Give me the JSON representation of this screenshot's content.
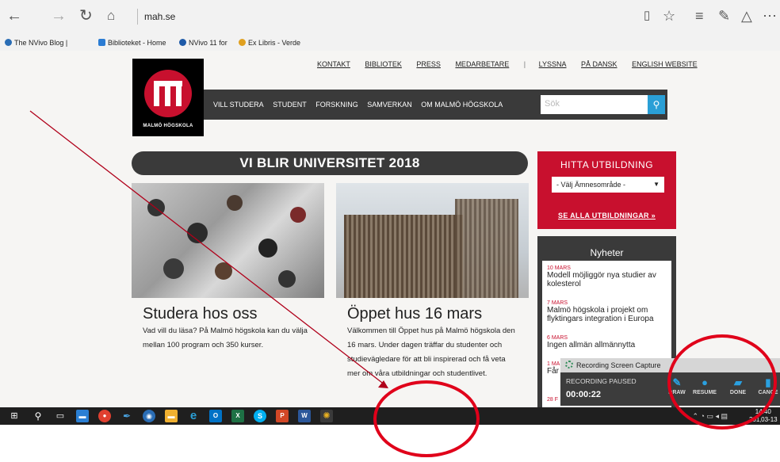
{
  "browser": {
    "url": "mah.se",
    "favorites": [
      {
        "label": "The NVivo Blog |",
        "color": "#2a6db5"
      },
      {
        "label": "Biblioteket - Home",
        "color": "#2b7cd3"
      },
      {
        "label": "NVivo 11 for",
        "color": "#1e5aa8"
      },
      {
        "label": "Ex Libris - Verde",
        "color": "#e0a020"
      }
    ]
  },
  "site": {
    "logo_text": "MALMÖ HÖGSKOLA",
    "top_links": [
      "KONTAKT",
      "BIBLIOTEK",
      "PRESS",
      "MEDARBETARE",
      "LYSSNA",
      "PÅ DANSK",
      "ENGLISH WEBSITE"
    ],
    "nav": [
      "VILL STUDERA",
      "STUDENT",
      "FORSKNING",
      "SAMVERKAN",
      "OM MALMÖ HÖGSKOLA"
    ],
    "search_placeholder": "Sök",
    "banner": "VI BLIR UNIVERSITET 2018",
    "cards": [
      {
        "title": "Studera hos oss",
        "text": "Vad vill du läsa? På Malmö högskola kan du välja mellan 100 program och 350 kurser."
      },
      {
        "title": "Öppet hus 16 mars",
        "text": "Välkommen till Öppet hus på Malmö högskola den 16 mars. Under dagen träffar du studenter och studievägledare för att bli inspirerad och få veta mer om våra utbildningar och studentlivet."
      }
    ],
    "hitta": {
      "title": "HITTA UTBILDNING",
      "select": "- Välj Ämnesområde -",
      "link": "SE ALLA UTBILDNINGAR »"
    },
    "nyheter": {
      "title": "Nyheter",
      "items": [
        {
          "date": "10 MARS",
          "head": "Modell möjliggör nya studier av kolesterol"
        },
        {
          "date": "7 MARS",
          "head": "Malmö högskola i projekt om flyktingars integration i Europa"
        },
        {
          "date": "6 MARS",
          "head": "Ingen allmän allmännytta"
        },
        {
          "date": "1 MA",
          "head": "Får än"
        },
        {
          "date": "28 F",
          "head": ""
        }
      ]
    },
    "brand_color": "#c8102e"
  },
  "recorder": {
    "title": "Recording Screen Capture",
    "status": "RECORDING PAUSED",
    "time": "00:00:22",
    "actions": [
      "DRAW",
      "RESUME",
      "DONE",
      "CANCE"
    ]
  },
  "taskbar": {
    "clock_time": "14:40",
    "clock_date": "201‚03-13"
  }
}
